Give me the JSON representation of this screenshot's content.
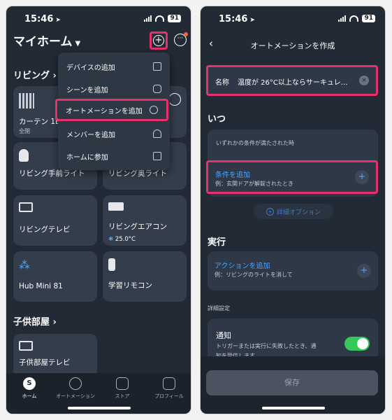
{
  "left": {
    "status": {
      "time": "15:46",
      "battery": "91"
    },
    "header": {
      "title": "マイホーム",
      "caret": "▼"
    },
    "sections": {
      "living": "リビング",
      "living_chev": "›",
      "kids": "子供部屋",
      "kids_chev": "›"
    },
    "tiles": {
      "curtain": {
        "name": "カーテン 1E",
        "sub": "全閉"
      },
      "front_light": {
        "name": "リビング手前ライト"
      },
      "back_light": {
        "name": "リビング奥ライト"
      },
      "tv": {
        "name": "リビングテレビ"
      },
      "aircon": {
        "name": "リビングエアコン",
        "sub": "25.0°C"
      },
      "hub": {
        "name": "Hub Mini 81"
      },
      "remote": {
        "name": "学習リモコン"
      },
      "kids_tv": {
        "name": "子供部屋テレビ"
      }
    },
    "dropdown": [
      {
        "label": "デバイスの追加",
        "icon": "device-icon"
      },
      {
        "label": "シーンを追加",
        "icon": "scene-icon"
      },
      {
        "label": "オートメーションを追加",
        "icon": "automation-icon"
      },
      {
        "label": "メンバーを追加",
        "icon": "person-icon"
      },
      {
        "label": "ホームに参加",
        "icon": "join-icon"
      }
    ],
    "tabs": {
      "home": "ホーム",
      "home_glyph": "S",
      "automation": "オートメーション",
      "store": "ストア",
      "profile": "プロフィール"
    }
  },
  "right": {
    "status": {
      "time": "15:46",
      "battery": "91"
    },
    "nav": {
      "back": "‹",
      "title": "オートメーションを作成"
    },
    "name_field": {
      "label": "名称",
      "value": "温度が 26°C以上ならサーキュレ…",
      "clear": "×"
    },
    "when": {
      "heading": "いつ",
      "condition_mode": "いずれかの条件が満たされた時",
      "add_condition": "条件を追加",
      "add_condition_hint": "例：玄関ドアが解錠されたとき",
      "plus": "+",
      "advanced": "詳細オプション"
    },
    "execute": {
      "heading": "実行",
      "add_action": "アクションを追加",
      "add_action_hint": "例：リビングのライトを消して",
      "plus": "+"
    },
    "advanced_settings": {
      "heading": "詳細設定",
      "notify_title": "通知",
      "notify_desc_1": "トリガーまたは実行に失敗したとき、通",
      "notify_desc_2": "知を受信します。",
      "notify_on": true
    },
    "save_label": "保存"
  },
  "colors": {
    "highlight": "#e8316c",
    "link": "#4ea3ff",
    "toggle_on": "#34c759",
    "bg": "#222a35"
  }
}
